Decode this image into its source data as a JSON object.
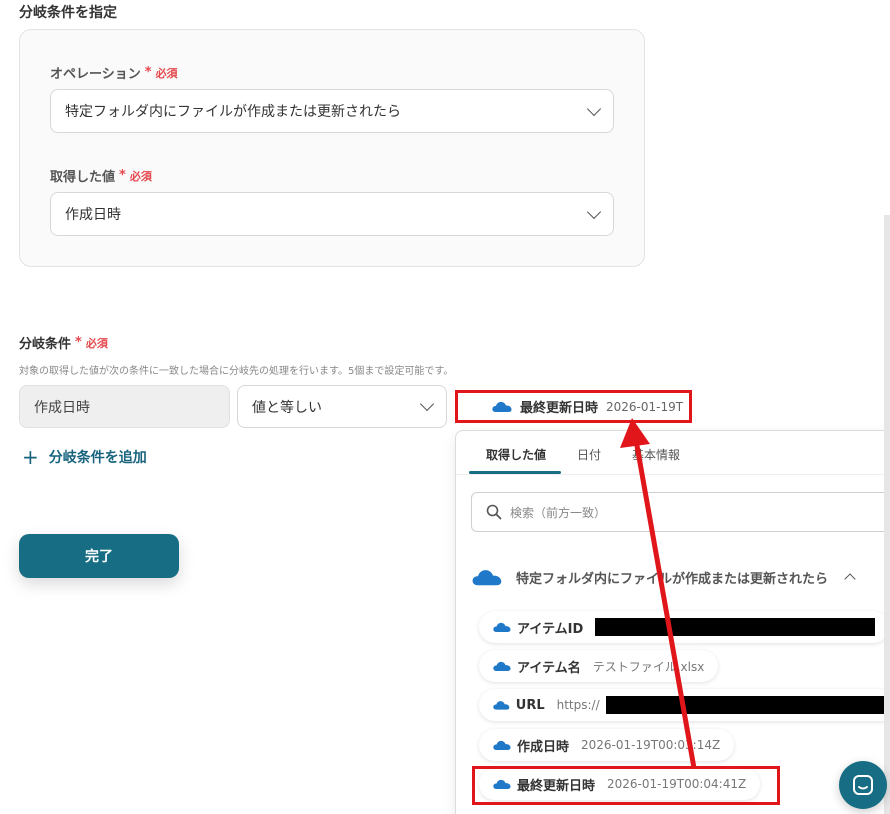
{
  "section_title": "分岐条件を指定",
  "required_text": "必須",
  "required_star": "*",
  "operation": {
    "label": "オペレーション",
    "value": "特定フォルダ内にファイルが作成または更新されたら"
  },
  "acquired_value": {
    "label": "取得した値",
    "value": "作成日時"
  },
  "condition": {
    "label": "分岐条件",
    "hint": "対象の取得した値が次の条件に一致した場合に分岐先の処理を行います。5個まで設定可能です。",
    "left_value": "作成日時",
    "operator": "値と等しい",
    "target_name": "最終更新日時",
    "target_value": "2026-01-19T"
  },
  "add_condition_label": "分岐条件を追加",
  "done_label": "完了",
  "panel": {
    "tabs": [
      "取得した値",
      "日付",
      "基本情報"
    ],
    "search_placeholder": "検索（前方一致）",
    "group_label": "特定フォルダ内にファイルが作成または更新されたら",
    "items": [
      {
        "name": "アイテムID",
        "value": ""
      },
      {
        "name": "アイテム名",
        "value": "テストファイル.xlsx"
      },
      {
        "name": "URL",
        "value": "https://"
      },
      {
        "name": "作成日時",
        "value": "2026-01-19T00:03:14Z"
      },
      {
        "name": "最終更新日時",
        "value": "2026-01-19T00:04:41Z"
      }
    ]
  },
  "colors": {
    "accent": "#176e84",
    "required": "#e5484d",
    "highlight": "#e0161b",
    "cloud": "#1f78c8"
  },
  "icons": {
    "onedrive": "onedrive-cloud-icon",
    "search": "search-icon",
    "chevron": "chevron-down-icon",
    "caret_up": "chevron-up-icon",
    "plus": "plus-icon",
    "chat": "chat-icon"
  }
}
